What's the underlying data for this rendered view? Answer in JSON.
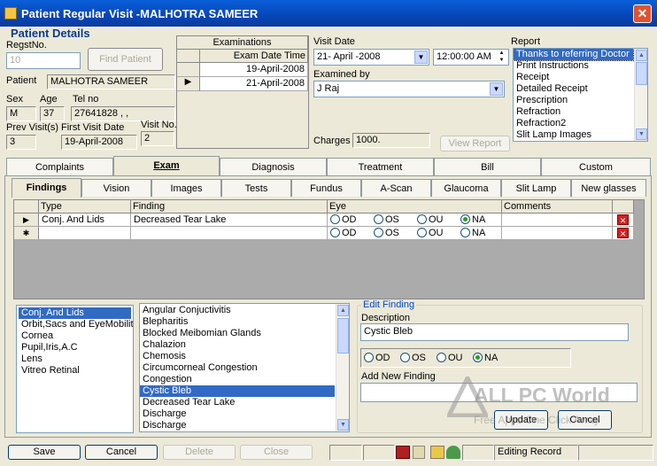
{
  "window": {
    "title": "Patient Regular Visit -MALHOTRA   SAMEER",
    "close_label": "✕"
  },
  "patient_details": {
    "heading": "Patient Details",
    "regst_label": "RegstNo.",
    "regst_value": "10",
    "find_button": "Find Patient",
    "patient_label": "Patient",
    "patient_value": "MALHOTRA   SAMEER",
    "sex_label": "Sex",
    "sex_value": "M",
    "age_label": "Age",
    "age_value": "37",
    "tel_label": "Tel no",
    "tel_value": "27641828 , ,",
    "prev_visits_label": "Prev Visit(s)",
    "prev_visits_value": "3",
    "first_visit_label": "First Visit Date",
    "first_visit_value": "19-April-2008",
    "visit_no_label": "Visit No.",
    "visit_no_value": "2"
  },
  "examinations": {
    "title": "Examinations",
    "column": "Exam Date Time",
    "rows": [
      "19-April-2008",
      "21-April-2008"
    ],
    "current_row_marker": "▶"
  },
  "visit": {
    "date_label": "Visit Date",
    "date_value": "21-    April    -2008",
    "time_value": "12:00:00 AM",
    "examined_by_label": "Examined by",
    "examined_by_value": "J Raj",
    "charges_label": "Charges",
    "charges_value": "1000.",
    "view_report_button": "View Report"
  },
  "report": {
    "label": "Report",
    "items": [
      "Thanks to referring Doctor",
      "Print Instructions",
      "Receipt",
      "Detailed Receipt",
      "Prescription",
      "Refraction",
      "Refraction2",
      "Slit Lamp Images"
    ],
    "selected": "Thanks to referring Doctor"
  },
  "main_tabs": [
    "Complaints",
    "Exam",
    "Diagnosis",
    "Treatment",
    "Bill",
    "Custom"
  ],
  "main_tab_selected": "Exam",
  "sub_tabs": [
    "Findings",
    "Vision",
    "Images",
    "Tests",
    "Fundus",
    "A-Scan",
    "Glaucoma",
    "Slit Lamp",
    "New glasses"
  ],
  "sub_tab_selected": "Findings",
  "findings_grid": {
    "columns": [
      "Type",
      "Finding",
      "Eye",
      "Comments"
    ],
    "eye_options": [
      "OD",
      "OS",
      "OU",
      "NA"
    ],
    "rows": [
      {
        "marker": "▶",
        "type": "Conj. And Lids",
        "finding": "Decreased Tear Lake",
        "eye": "NA",
        "comments": ""
      },
      {
        "marker": "✱",
        "type": "",
        "finding": "",
        "eye": "",
        "comments": ""
      }
    ],
    "delete_glyph": "✕"
  },
  "type_list": {
    "items": [
      "Conj. And Lids",
      "Orbit,Sacs and EyeMobility",
      "Cornea",
      "Pupil,Iris,A.C",
      "Lens",
      "Vitreo Retinal"
    ],
    "selected": "Conj. And Lids"
  },
  "finding_list": {
    "items": [
      "Angular Conjuctivitis",
      "Blepharitis",
      "Blocked Meibomian Glands",
      "Chalazion",
      "Chemosis",
      "Circumcorneal Congestion",
      "Congestion",
      "Cystic Bleb",
      "Decreased Tear Lake",
      "Discharge",
      "Discharge"
    ],
    "selected": "Cystic Bleb"
  },
  "edit_finding": {
    "title": "Edit Finding",
    "description_label": "Description",
    "description_value": "Cystic Bleb",
    "eye_options": [
      "OD",
      "OS",
      "OU",
      "NA"
    ],
    "eye_selected": "NA",
    "add_new_label": "Add New Finding",
    "add_new_value": "",
    "update_button": "Update",
    "cancel_button": "Cancel"
  },
  "bottom_bar": {
    "save": "Save",
    "cancel": "Cancel",
    "delete": "Delete",
    "close": "Close",
    "status": "Editing Record"
  },
  "watermark": {
    "line1": "ALL PC World",
    "line2": "Free Apps One Click Away"
  },
  "colors": {
    "title_bar": "#0646b8",
    "selection": "#316ac5",
    "delete_icon": "#d42020",
    "window_bg": "#ece9d8"
  }
}
